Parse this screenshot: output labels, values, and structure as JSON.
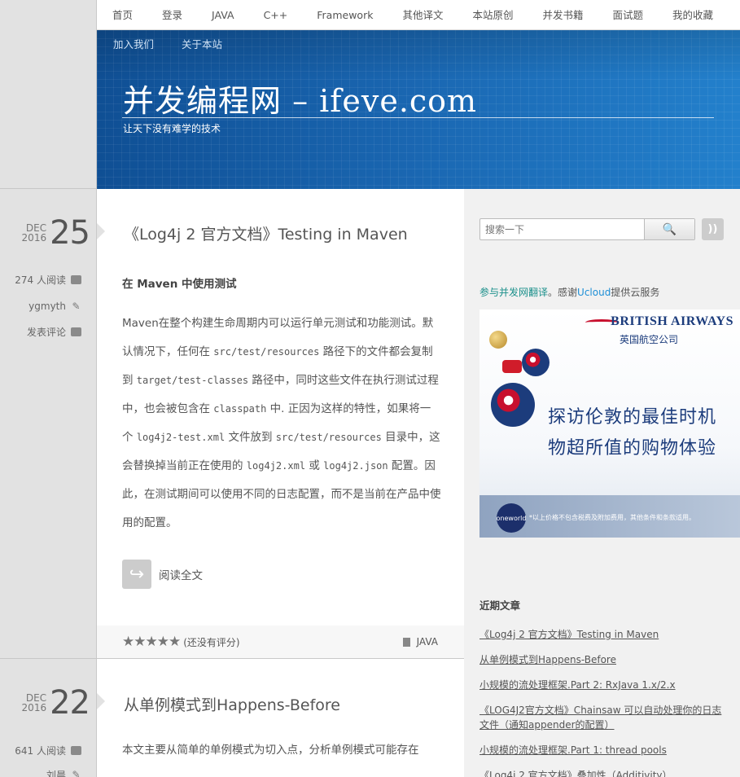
{
  "nav": {
    "items": [
      "首页",
      "登录",
      "JAVA",
      "C++",
      "Framework",
      "其他译文",
      "本站原创",
      "并发书籍",
      "面试题",
      "我的收藏"
    ],
    "sub_items": [
      "加入我们",
      "关于本站"
    ]
  },
  "site": {
    "title": "并发编程网 – ifeve.com",
    "tagline": "让天下没有难学的技术"
  },
  "posts": [
    {
      "month": "DEC",
      "year": "2016",
      "day": "25",
      "reads": "274 人阅读",
      "author": "ygmyth",
      "comment": "发表评论",
      "title": "《Log4j 2 官方文档》Testing in Maven",
      "subheading": "在 Maven 中使用测试",
      "body": {
        "t1": "Maven在整个构建生命周期内可以运行单元测试和功能测试。默认情况下，任何在 ",
        "c1": "src/test/resources",
        "t2": " 路径下的文件都会复制到 ",
        "c2": "target/test-classes",
        "t3": " 路径中，同时这些文件在执行测试过程中，也会被包含在 ",
        "c3": "classpath",
        "t4": " 中. 正因为这样的特性，如果将一个 ",
        "c4": "log4j2-test.xml",
        "t5": " 文件放到 ",
        "c5": "src/test/resources",
        "t6": " 目录中，这会替换掉当前正在使用的 ",
        "c6": "log4j2.xml",
        "t7": " 或 ",
        "c7": "log4j2.json",
        "t8": " 配置。因此，在测试期间可以使用不同的日志配置，而不是当前在产品中使用的配置。"
      },
      "read_more": "阅读全文",
      "rating_text": "(还没有评分)",
      "rating": 0,
      "category": "JAVA"
    },
    {
      "month": "DEC",
      "year": "2016",
      "day": "22",
      "reads": "641 人阅读",
      "author": "刘晨",
      "title": "从单例模式到Happens-Before",
      "excerpt": "本文主要从简单的单例模式为切入点，分析单例模式可能存在"
    }
  ],
  "sidebar": {
    "search_placeholder": "搜索一下",
    "credit_link": "参与并发网翻译",
    "credit_mid": "。感谢",
    "credit_brand": "Ucloud",
    "credit_end": "提供云服务",
    "ad": {
      "brand": "BRITISH AIRWAYS",
      "brand_cn": "英国航空公司",
      "line1": "探访伦敦的最佳时机",
      "line2": "物超所值的购物体验",
      "oneworld": "oneworld",
      "fine_print": "*以上价格不包含税费及附加费用，其他条件和条款适用。"
    },
    "recent_title": "近期文章",
    "recent": [
      "《Log4j 2 官方文档》Testing in Maven",
      "从单例模式到Happens-Before",
      "小规模的流处理框架.Part 2: RxJava 1.x/2.x",
      "《LOG4J2官方文档》Chainsaw 可以自动处理你的日志文件（通知appender的配置）",
      "小规模的流处理框架.Part 1: thread pools",
      "《Log4j 2 官方文档》叠加性（Additivity）"
    ]
  },
  "colors": {
    "banner": "#1a67b2",
    "link_teal": "#1a8f8a"
  }
}
